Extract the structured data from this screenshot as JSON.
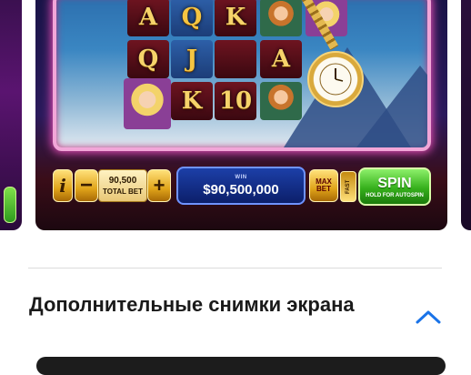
{
  "screenshots": {
    "main": {
      "reels": [
        [
          "A",
          "Q",
          "K",
          "",
          ""
        ],
        [
          "Q",
          "J",
          "",
          "A",
          ""
        ],
        [
          "",
          "K",
          "10",
          "",
          ""
        ]
      ],
      "controls": {
        "info_label": "i",
        "minus_label": "−",
        "total_bet_value": "90,500",
        "total_bet_label": "TOTAL BET",
        "plus_label": "+",
        "win_label": "WIN",
        "win_value": "$90,500,000",
        "max_bet_line1": "MAX",
        "max_bet_line2": "BET",
        "fast_label": "FAST",
        "spin_label": "SPIN",
        "spin_sublabel": "HOLD FOR AUTOSPIN"
      }
    }
  },
  "section": {
    "title": "Дополнительные снимки экрана",
    "toggle_icon": "chevron-up-icon",
    "accent_color": "#1a73e8"
  }
}
